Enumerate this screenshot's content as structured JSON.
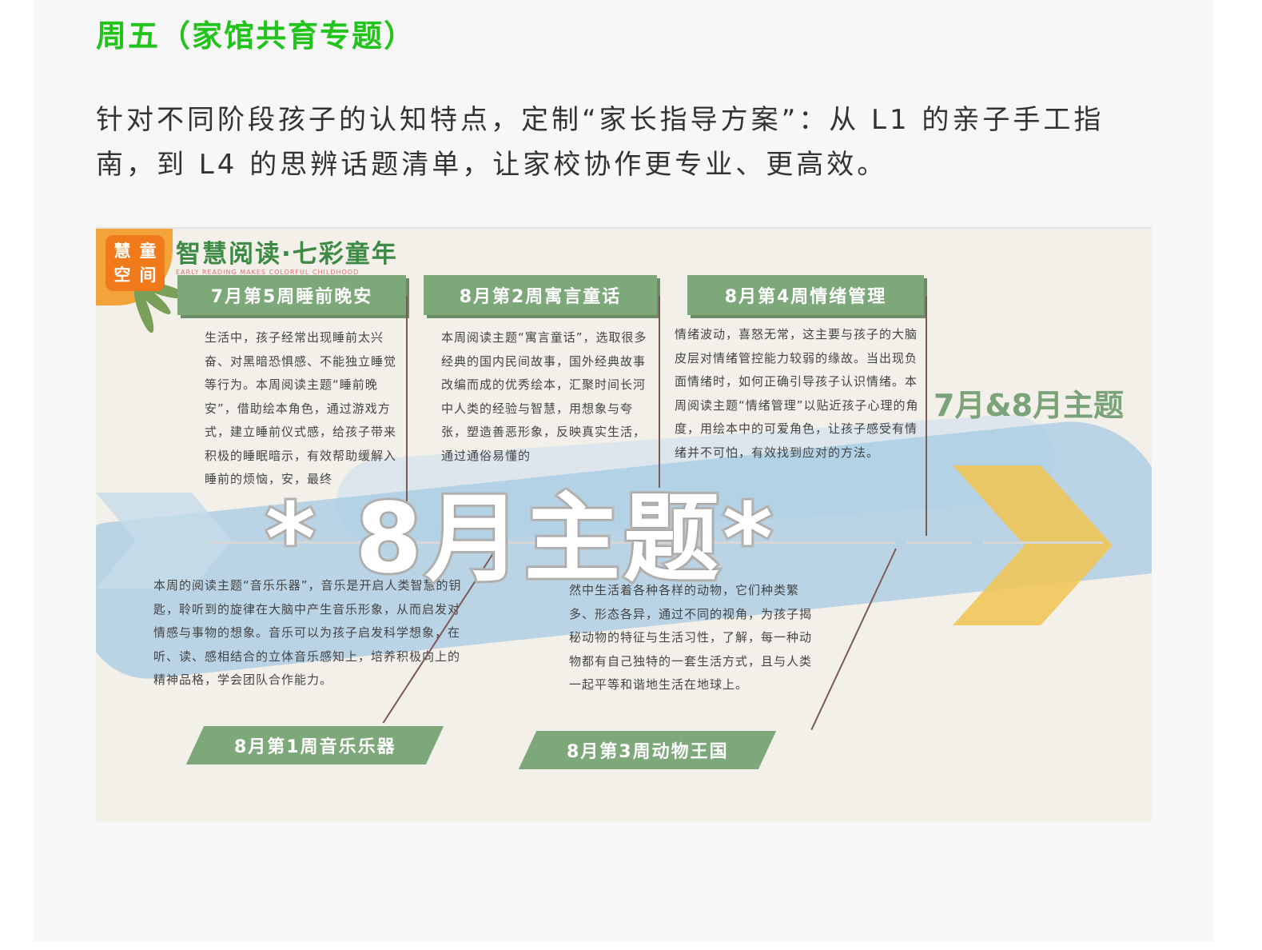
{
  "section": {
    "title": "周五（家馆共育专题）",
    "intro": "针对不同阶段孩子的认知特点，定制“家长指导方案”：从 L1 的亲子手工指南，到 L4 的思辨话题清单，让家校协作更专业、更高效。"
  },
  "poster": {
    "logo_chars": [
      "慧",
      "童",
      "空",
      "间"
    ],
    "brand_title": "智慧阅读·七彩童年",
    "brand_subtitle": "EARLY READING MAKES COLORFUL CHILDHOOD",
    "overlay_title": "* 8月主题*",
    "theme_label": "7月&8月主题",
    "weeks_top": [
      {
        "title": "7月第5周睡前晚安",
        "text": "生活中，孩子经常出现睡前太兴奋、对黑暗恐惧感、不能独立睡觉等行为。本周阅读主题“睡前晚安”，借助绘本角色，通过游戏方式，建立睡前仪式感，给孩子带来积极的睡眠暗示，有效帮助缓解入睡前的烦恼，安，最终"
      },
      {
        "title": "8月第2周寓言童话",
        "text": "本周阅读主题“寓言童话”，选取很多经典的国内民间故事，国外经典故事改编而成的优秀绘本，汇聚时间长河中人类的经验与智慧，用想象与夸张，塑造善恶形象，反映真实生活，通过通俗易懂的"
      },
      {
        "title": "8月第4周情绪管理",
        "text": "情绪波动，喜怒无常，这主要与孩子的大脑皮层对情绪管控能力较弱的缘故。当出现负面情绪时，如何正确引导孩子认识情绪。本周阅读主题“情绪管理”以贴近孩子心理的角度，用绘本中的可爱角色，让孩子感受有情绪并不可怕，有效找到应对的方法。"
      }
    ],
    "weeks_bottom": [
      {
        "title": "8月第1周音乐乐器",
        "text": "本周的阅读主题“音乐乐器”，音乐是开启人类智慧的钥匙，聆听到的旋律在大脑中产生音乐形象，从而启发对情感与事物的想象。音乐可以为孩子启发科学想象，在听、读、感相结合的立体音乐感知上，培养积极向上的精神品格，学会团队合作能力。"
      },
      {
        "title": "8月第3周动物王国",
        "text": "然中生活着各种各样的动物，它们种类繁多、形态各异，通过不同的视角，为孩子揭秘动物的特征与生活习性，了解，每一种动物都有自己独特的一套生活方式，且与人类一起平等和谐地生活在地球上。"
      }
    ]
  }
}
